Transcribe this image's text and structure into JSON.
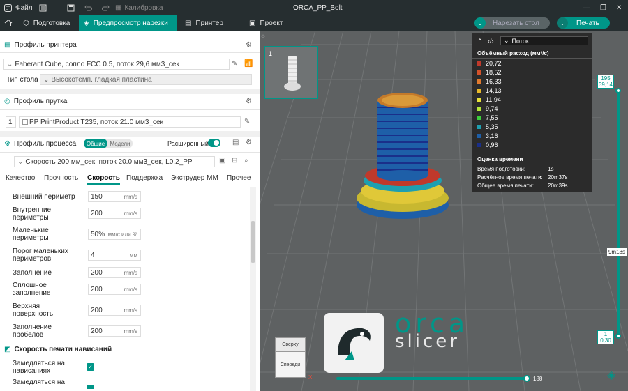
{
  "titlebar": {
    "file": "Файл",
    "calibration": "Калибровка",
    "title": "ORCA_PP_Bolt"
  },
  "tabs": [
    {
      "label": "Подготовка"
    },
    {
      "label": "Предпросмотр нарезки"
    },
    {
      "label": "Принтер"
    },
    {
      "label": "Проект"
    }
  ],
  "actions": {
    "slice": "Нарезать стол",
    "print": "Печать"
  },
  "printer": {
    "section": "Профиль принтера",
    "profile": "Faberant Cube, сопло FCC 0.5, поток 29,6 мм3_сек",
    "bed_label": "Тип стола",
    "bed_value": "Высокотемп. гладкая пластина"
  },
  "filament": {
    "section": "Профиль прутка",
    "index": "1",
    "profile": "PP PrintProduct T235, поток 21.0 мм3_сек"
  },
  "process": {
    "section": "Профиль процесса",
    "toggle_global": "Общие",
    "toggle_objects": "Модели",
    "advanced": "Расширенный",
    "profile": "Скорость 200 мм_сек, поток 20.0 мм3_сек, L0.2_PP"
  },
  "subtabs": [
    "Качество",
    "Прочность",
    "Скорость",
    "Поддержка",
    "Экструдер ММ",
    "Прочее"
  ],
  "settings": [
    {
      "label": "Внешний периметр",
      "value": "150",
      "unit": "mm/s"
    },
    {
      "label": "Внутренние\nпериметры",
      "value": "200",
      "unit": "mm/s"
    },
    {
      "label": "Маленькие\nпериметры",
      "value": "50%",
      "unit": "мм/с или %"
    },
    {
      "label": "Порог маленьких\nпериметров",
      "value": "4",
      "unit": "мм"
    },
    {
      "label": "Заполнение",
      "value": "200",
      "unit": "mm/s"
    },
    {
      "label": "Сплошное\nзаполнение",
      "value": "200",
      "unit": "mm/s"
    },
    {
      "label": "Верхняя\nповерхность",
      "value": "200",
      "unit": "mm/s"
    },
    {
      "label": "Заполнение\nпробелов",
      "value": "200",
      "unit": "mm/s"
    }
  ],
  "overhang": {
    "section": "Скорость печати нависаний",
    "slow_label": "Замедляться на\nнависаниях",
    "slow2_label": "Замедляться на"
  },
  "plate": {
    "number": "1"
  },
  "legend": {
    "mode": "Поток",
    "title": "Объёмный расход (мм³/с)",
    "items": [
      {
        "value": "20,72",
        "color": "#c0392b"
      },
      {
        "value": "18,52",
        "color": "#d4522a"
      },
      {
        "value": "16,33",
        "color": "#e07a2e"
      },
      {
        "value": "14,13",
        "color": "#e8b92a"
      },
      {
        "value": "11,94",
        "color": "#e8e23a"
      },
      {
        "value": "9,74",
        "color": "#b6e83a"
      },
      {
        "value": "7,55",
        "color": "#3ccf3c"
      },
      {
        "value": "5,35",
        "color": "#1e9fb0"
      },
      {
        "value": "3,16",
        "color": "#1e5fa8"
      },
      {
        "value": "0,96",
        "color": "#1a2f8a"
      }
    ],
    "time_title": "Оценка времени",
    "prep_label": "Время подготовки:",
    "prep_value": "1s",
    "calc_label": "Расчётное время печати:",
    "calc_value": "20m37s",
    "total_label": "Общее время печати:",
    "total_value": "20m39s"
  },
  "vslider": {
    "top_layer": "195",
    "top_height": "39,14",
    "time": "9m18s",
    "bottom_layer": "1",
    "bottom_height": "0,30"
  },
  "hslider": {
    "value": "188"
  },
  "viewcube": {
    "top": "Сверху",
    "front": "Спереди",
    "axis_x": "X"
  },
  "logo": {
    "line1": "orca",
    "line2": "slicer"
  },
  "colors": {
    "accent": "#009688",
    "bar": "#262e30",
    "viewport": "#5e6162"
  }
}
